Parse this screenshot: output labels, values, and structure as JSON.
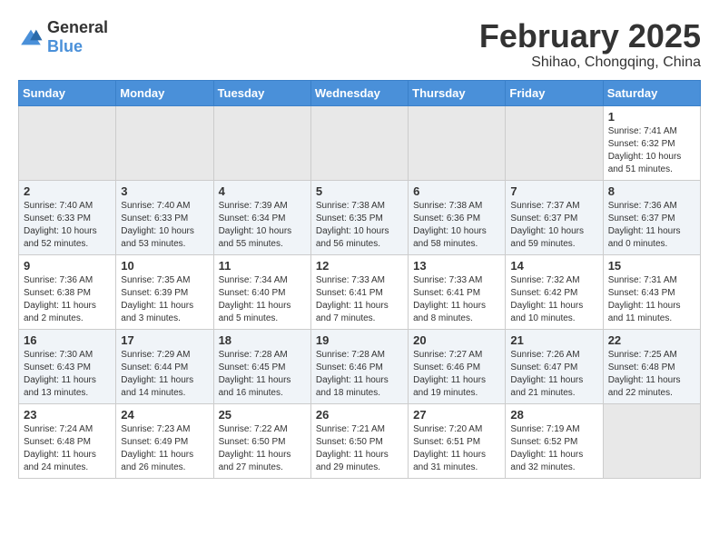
{
  "logo": {
    "text_general": "General",
    "text_blue": "Blue"
  },
  "title": "February 2025",
  "subtitle": "Shihao, Chongqing, China",
  "days_of_week": [
    "Sunday",
    "Monday",
    "Tuesday",
    "Wednesday",
    "Thursday",
    "Friday",
    "Saturday"
  ],
  "weeks": [
    [
      {
        "day": "",
        "info": ""
      },
      {
        "day": "",
        "info": ""
      },
      {
        "day": "",
        "info": ""
      },
      {
        "day": "",
        "info": ""
      },
      {
        "day": "",
        "info": ""
      },
      {
        "day": "",
        "info": ""
      },
      {
        "day": "1",
        "info": "Sunrise: 7:41 AM\nSunset: 6:32 PM\nDaylight: 10 hours and 51 minutes."
      }
    ],
    [
      {
        "day": "2",
        "info": "Sunrise: 7:40 AM\nSunset: 6:33 PM\nDaylight: 10 hours and 52 minutes."
      },
      {
        "day": "3",
        "info": "Sunrise: 7:40 AM\nSunset: 6:33 PM\nDaylight: 10 hours and 53 minutes."
      },
      {
        "day": "4",
        "info": "Sunrise: 7:39 AM\nSunset: 6:34 PM\nDaylight: 10 hours and 55 minutes."
      },
      {
        "day": "5",
        "info": "Sunrise: 7:38 AM\nSunset: 6:35 PM\nDaylight: 10 hours and 56 minutes."
      },
      {
        "day": "6",
        "info": "Sunrise: 7:38 AM\nSunset: 6:36 PM\nDaylight: 10 hours and 58 minutes."
      },
      {
        "day": "7",
        "info": "Sunrise: 7:37 AM\nSunset: 6:37 PM\nDaylight: 10 hours and 59 minutes."
      },
      {
        "day": "8",
        "info": "Sunrise: 7:36 AM\nSunset: 6:37 PM\nDaylight: 11 hours and 0 minutes."
      }
    ],
    [
      {
        "day": "9",
        "info": "Sunrise: 7:36 AM\nSunset: 6:38 PM\nDaylight: 11 hours and 2 minutes."
      },
      {
        "day": "10",
        "info": "Sunrise: 7:35 AM\nSunset: 6:39 PM\nDaylight: 11 hours and 3 minutes."
      },
      {
        "day": "11",
        "info": "Sunrise: 7:34 AM\nSunset: 6:40 PM\nDaylight: 11 hours and 5 minutes."
      },
      {
        "day": "12",
        "info": "Sunrise: 7:33 AM\nSunset: 6:41 PM\nDaylight: 11 hours and 7 minutes."
      },
      {
        "day": "13",
        "info": "Sunrise: 7:33 AM\nSunset: 6:41 PM\nDaylight: 11 hours and 8 minutes."
      },
      {
        "day": "14",
        "info": "Sunrise: 7:32 AM\nSunset: 6:42 PM\nDaylight: 11 hours and 10 minutes."
      },
      {
        "day": "15",
        "info": "Sunrise: 7:31 AM\nSunset: 6:43 PM\nDaylight: 11 hours and 11 minutes."
      }
    ],
    [
      {
        "day": "16",
        "info": "Sunrise: 7:30 AM\nSunset: 6:43 PM\nDaylight: 11 hours and 13 minutes."
      },
      {
        "day": "17",
        "info": "Sunrise: 7:29 AM\nSunset: 6:44 PM\nDaylight: 11 hours and 14 minutes."
      },
      {
        "day": "18",
        "info": "Sunrise: 7:28 AM\nSunset: 6:45 PM\nDaylight: 11 hours and 16 minutes."
      },
      {
        "day": "19",
        "info": "Sunrise: 7:28 AM\nSunset: 6:46 PM\nDaylight: 11 hours and 18 minutes."
      },
      {
        "day": "20",
        "info": "Sunrise: 7:27 AM\nSunset: 6:46 PM\nDaylight: 11 hours and 19 minutes."
      },
      {
        "day": "21",
        "info": "Sunrise: 7:26 AM\nSunset: 6:47 PM\nDaylight: 11 hours and 21 minutes."
      },
      {
        "day": "22",
        "info": "Sunrise: 7:25 AM\nSunset: 6:48 PM\nDaylight: 11 hours and 22 minutes."
      }
    ],
    [
      {
        "day": "23",
        "info": "Sunrise: 7:24 AM\nSunset: 6:48 PM\nDaylight: 11 hours and 24 minutes."
      },
      {
        "day": "24",
        "info": "Sunrise: 7:23 AM\nSunset: 6:49 PM\nDaylight: 11 hours and 26 minutes."
      },
      {
        "day": "25",
        "info": "Sunrise: 7:22 AM\nSunset: 6:50 PM\nDaylight: 11 hours and 27 minutes."
      },
      {
        "day": "26",
        "info": "Sunrise: 7:21 AM\nSunset: 6:50 PM\nDaylight: 11 hours and 29 minutes."
      },
      {
        "day": "27",
        "info": "Sunrise: 7:20 AM\nSunset: 6:51 PM\nDaylight: 11 hours and 31 minutes."
      },
      {
        "day": "28",
        "info": "Sunrise: 7:19 AM\nSunset: 6:52 PM\nDaylight: 11 hours and 32 minutes."
      },
      {
        "day": "",
        "info": ""
      }
    ]
  ]
}
